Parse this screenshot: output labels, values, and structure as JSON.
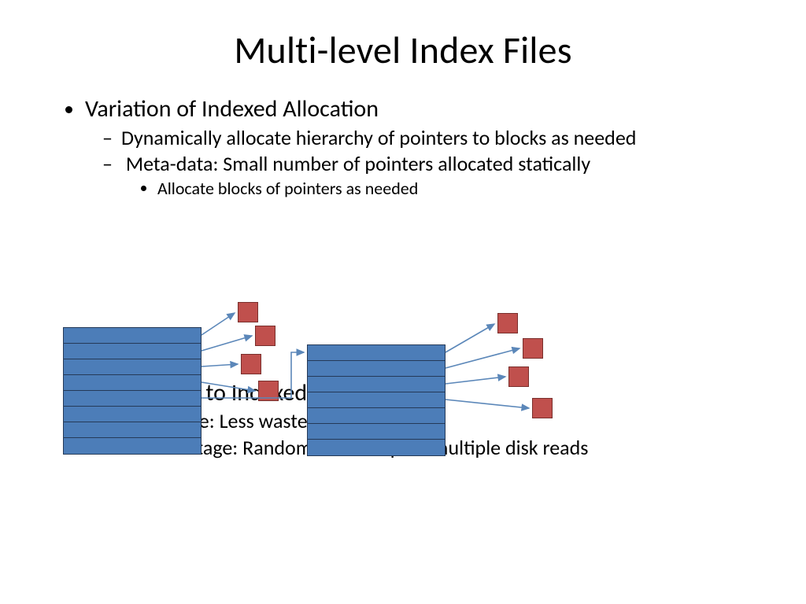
{
  "title": "Multi-level Index Files",
  "bullets": {
    "item1": "Variation of Indexed Allocation",
    "item1_sub1": "Dynamically allocate hierarchy of pointers to blocks as needed",
    "item1_sub2": "Meta-data: Small number of pointers allocated statically",
    "item1_sub2_sub1": "Allocate blocks of pointers as needed",
    "item2": "Comparison to Indexed Allocation",
    "item2_sub1": "Advantage: Less wasted space",
    "item2_sub2": "Disadvantage: Random reads require multiple disk reads"
  },
  "diagram": {
    "table1_rows": 8,
    "table2_rows": 7,
    "red_blocks": 8,
    "colors": {
      "table_fill": "#4c7db8",
      "table_border": "#253a58",
      "block_fill": "#c0504d",
      "block_border": "#7a2f2c",
      "arrow": "#5b87b9"
    }
  }
}
